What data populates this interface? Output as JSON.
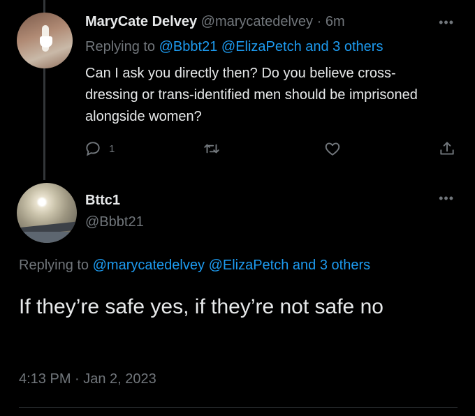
{
  "tweet1": {
    "name": "MaryCate Delvey",
    "handle": "@marycatedelvey",
    "sep": "·",
    "time": "6m",
    "replying_prefix": "Replying to",
    "mention1": "@Bbbt21",
    "mention2": "@ElizaPetch",
    "others": "and 3 others",
    "text": "Can I ask you directly then? Do you believe cross-dressing or trans-identified men should be imprisoned alongside women?",
    "reply_count": "1"
  },
  "tweet2": {
    "name": "Bttc1",
    "handle": "@Bbbt21",
    "replying_prefix": "Replying to",
    "mention1": "@marycatedelvey",
    "mention2": "@ElizaPetch",
    "others": "and 3 others",
    "text": "If they’re safe yes, if they’re not safe no",
    "timestamp": "4:13 PM · Jan 2, 2023"
  },
  "more_glyph": "•••",
  "icons": [
    "reply-icon",
    "retweet-icon",
    "like-icon",
    "share-icon",
    "more-icon"
  ],
  "colors": {
    "background": "#000000",
    "text": "#e7e9ea",
    "muted": "#71767b",
    "link": "#1d9bf0"
  }
}
